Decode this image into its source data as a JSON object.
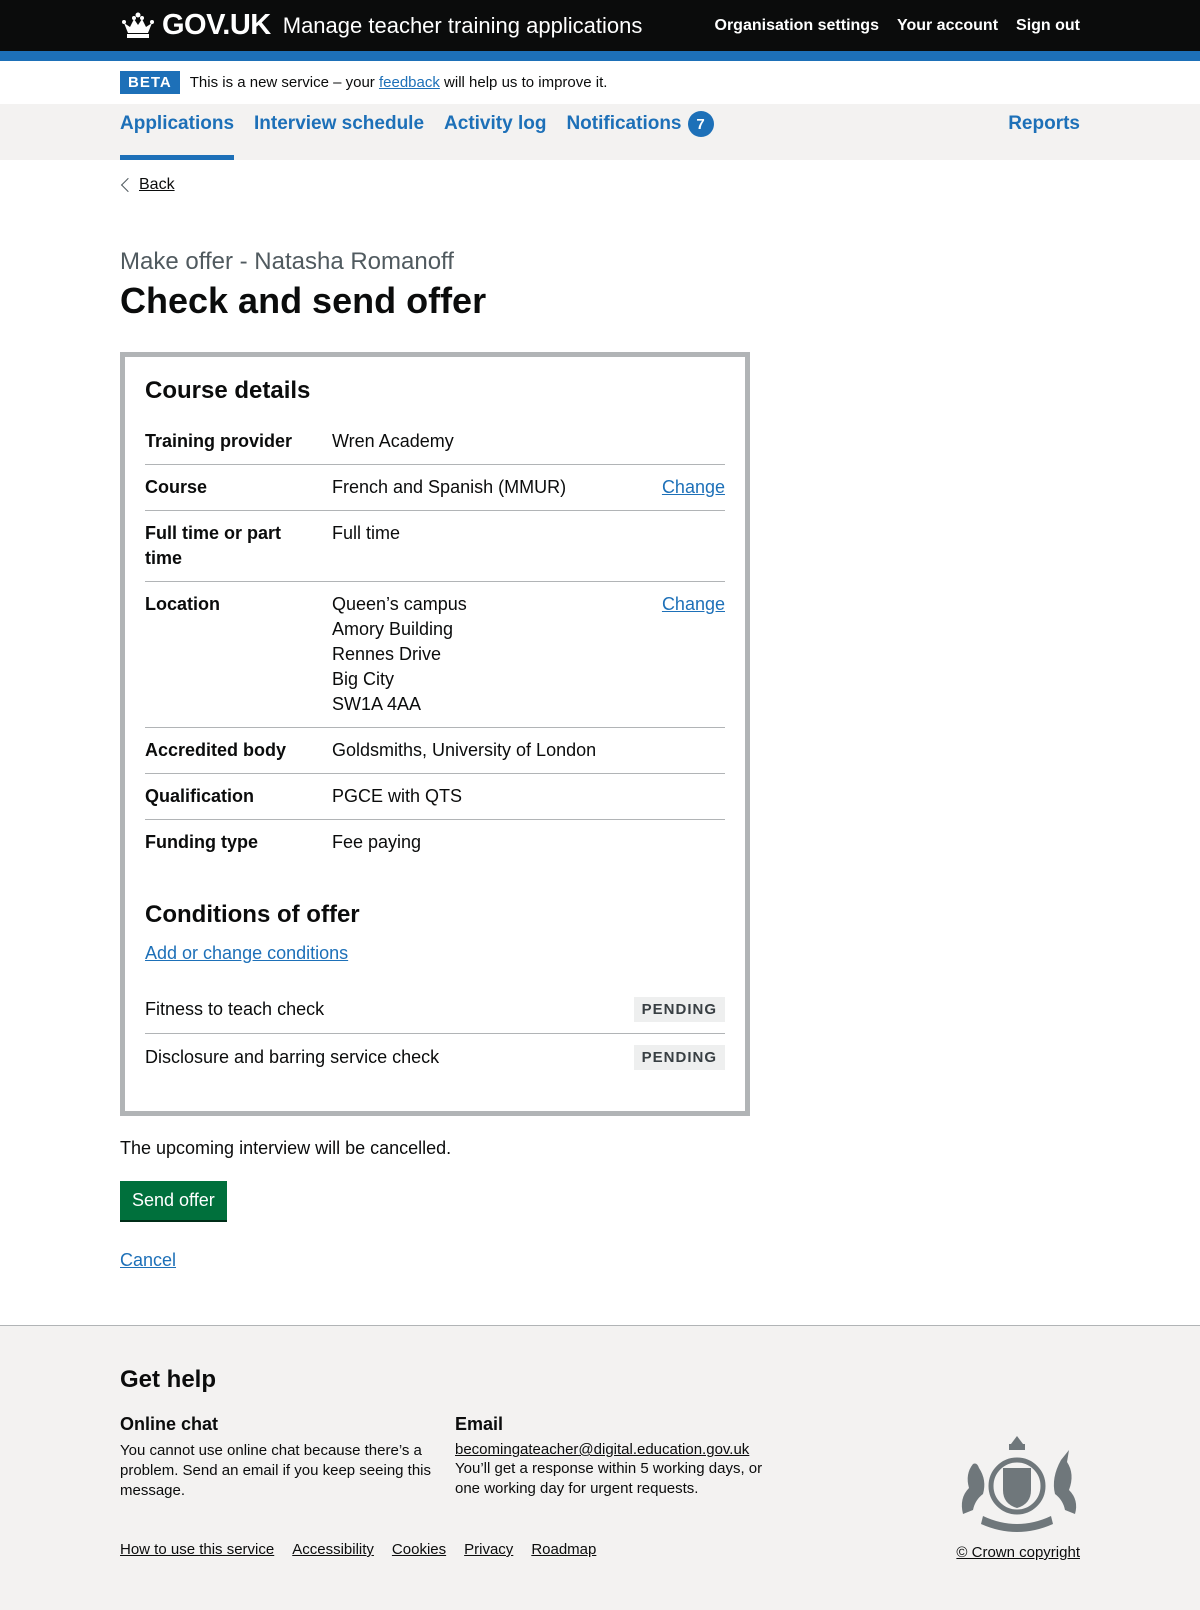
{
  "header": {
    "logo_text": "GOV.UK",
    "service_name": "Manage teacher training applications",
    "nav": [
      "Organisation settings",
      "Your account",
      "Sign out"
    ]
  },
  "beta": {
    "tag": "BETA",
    "text_before": "This is a new service – your ",
    "link": "feedback",
    "text_after": " will help us to improve it."
  },
  "primary_nav": {
    "items": [
      "Applications",
      "Interview schedule",
      "Activity log",
      "Notifications"
    ],
    "notifications_count": "7",
    "reports": "Reports"
  },
  "back": "Back",
  "caption": "Make offer - Natasha Romanoff",
  "title": "Check and send offer",
  "course_details": {
    "heading": "Course details",
    "rows": [
      {
        "key": "Training provider",
        "value": "Wren Academy",
        "action": ""
      },
      {
        "key": "Course",
        "value": "French and Spanish (MMUR)",
        "action": "Change"
      },
      {
        "key": "Full time or part time",
        "value": "Full time",
        "action": ""
      },
      {
        "key": "Location",
        "value_lines": [
          "Queen’s campus",
          "Amory Building",
          "Rennes Drive",
          "Big City",
          "SW1A 4AA"
        ],
        "action": "Change"
      },
      {
        "key": "Accredited body",
        "value": "Goldsmiths, University of London",
        "action": ""
      },
      {
        "key": "Qualification",
        "value": "PGCE with QTS",
        "action": ""
      },
      {
        "key": "Funding type",
        "value": "Fee paying",
        "action": ""
      }
    ]
  },
  "conditions": {
    "heading": "Conditions of offer",
    "add_link": "Add or change conditions",
    "items": [
      {
        "text": "Fitness to teach check",
        "status": "PENDING"
      },
      {
        "text": "Disclosure and barring service check",
        "status": "PENDING"
      }
    ]
  },
  "note": "The upcoming interview will be cancelled.",
  "send_button": "Send offer",
  "cancel": "Cancel",
  "footer": {
    "heading": "Get help",
    "online_chat_title": "Online chat",
    "online_chat_text": "You cannot use online chat because there’s a problem. Send an email if you keep seeing this message.",
    "email_title": "Email",
    "email_address": "becomingateacher@digital.education.gov.uk",
    "email_text": "You’ll get a response within 5 working days, or one working day for urgent requests.",
    "links": [
      "How to use this service",
      "Accessibility",
      "Cookies",
      "Privacy",
      "Roadmap"
    ],
    "copyright": "© Crown copyright"
  }
}
